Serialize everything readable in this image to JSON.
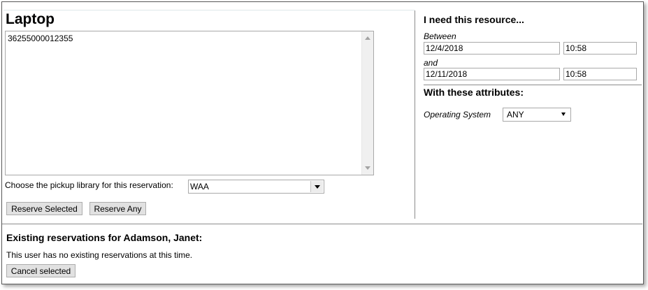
{
  "resource": {
    "title": "Laptop",
    "barcodes": [
      "36255000012355"
    ]
  },
  "pickup": {
    "label": "Choose the pickup library for this reservation:",
    "selected": "WAA"
  },
  "actions": {
    "reserve_selected": "Reserve Selected",
    "reserve_any": "Reserve Any"
  },
  "need": {
    "heading": "I need this resource...",
    "between_label": "Between",
    "start_date": "12/4/2018",
    "start_time": "10:58",
    "and_label": "and",
    "end_date": "12/11/2018",
    "end_time": "10:58"
  },
  "attributes": {
    "heading": "With these attributes:",
    "os_label": "Operating System",
    "os_value": "ANY"
  },
  "existing": {
    "heading": "Existing reservations for Adamson, Janet:",
    "message": "This user has no existing reservations at this time.",
    "cancel_label": "Cancel selected"
  }
}
